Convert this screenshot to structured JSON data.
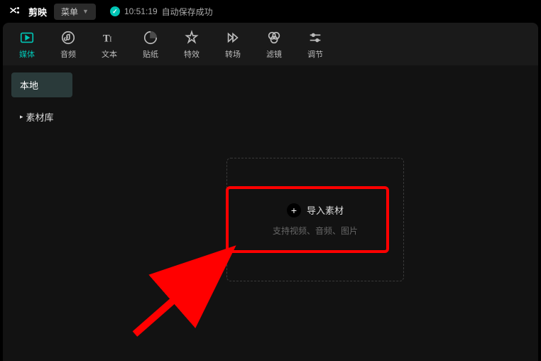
{
  "titlebar": {
    "app_name": "剪映",
    "menu_label": "菜单",
    "status_timestamp": "10:51:19",
    "status_text": "自动保存成功"
  },
  "toolbar": {
    "items": [
      {
        "label": "媒体",
        "icon": "media"
      },
      {
        "label": "音频",
        "icon": "audio"
      },
      {
        "label": "文本",
        "icon": "text"
      },
      {
        "label": "贴纸",
        "icon": "sticker"
      },
      {
        "label": "特效",
        "icon": "effect"
      },
      {
        "label": "转场",
        "icon": "transition"
      },
      {
        "label": "滤镜",
        "icon": "filter"
      },
      {
        "label": "调节",
        "icon": "adjust"
      }
    ]
  },
  "sidebar": {
    "items": [
      {
        "label": "本地",
        "expandable": false
      },
      {
        "label": "素材库",
        "expandable": true
      }
    ]
  },
  "import": {
    "label": "导入素材",
    "hint": "支持视频、音频、图片"
  }
}
